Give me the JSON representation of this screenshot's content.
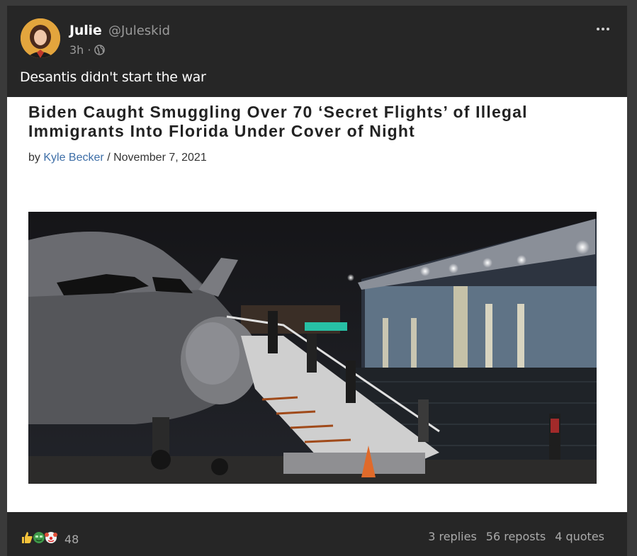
{
  "post": {
    "display_name": "Julie",
    "handle": "@Juleskid",
    "time": "3h",
    "separator": "·",
    "visibility_icon": "globe-icon",
    "text": "Desantis didn't start the war"
  },
  "article": {
    "headline": "Biden Caught Smuggling Over 70 ‘Secret Flights’ of Illegal Immigrants Into Florida Under Cover of Night",
    "by": "by",
    "author": "Kyle Becker",
    "slash": "/",
    "date": "November 7, 2021"
  },
  "footer": {
    "reaction_icons": [
      "thumbs-up-icon",
      "money-face-icon",
      "clown-face-icon"
    ],
    "reactions_count": "48",
    "replies": "3 replies",
    "reposts": "56 reposts",
    "quotes": "4 quotes"
  },
  "colors": {
    "card_bg": "#262626",
    "page_bg": "#3a3a3a",
    "link": "#3d6ea7"
  }
}
